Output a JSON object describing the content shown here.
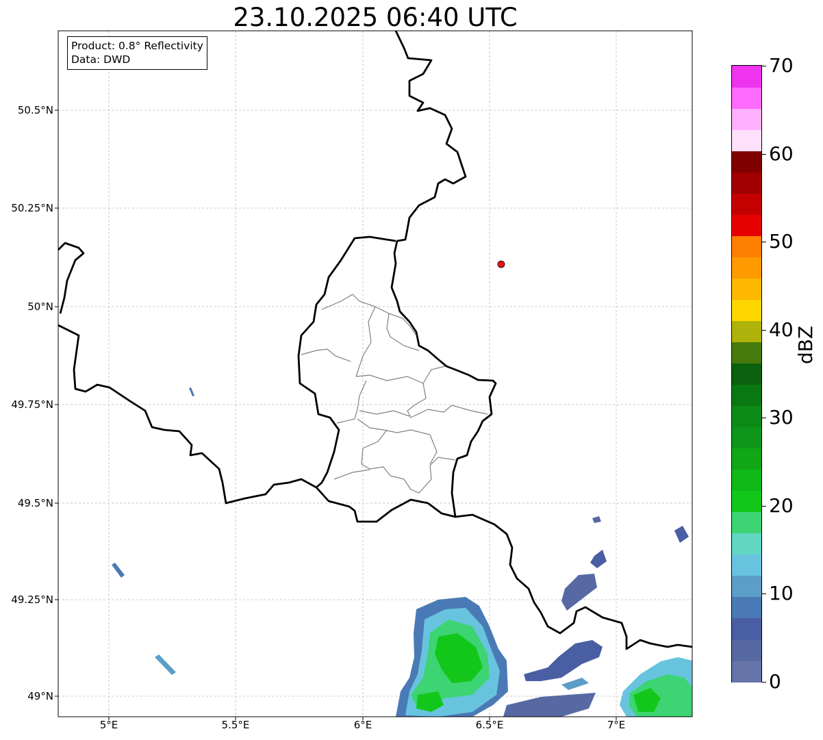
{
  "title": "23.10.2025 06:40 UTC",
  "info": {
    "product": "Product: 0.8° Reflectivity",
    "source": "Data: DWD"
  },
  "axes": {
    "lon_ticks": [
      "5°E",
      "5.5°E",
      "6°E",
      "6.5°E",
      "7°E"
    ],
    "lat_ticks": [
      "50.5°N",
      "50.25°N",
      "50°N",
      "49.75°N",
      "49.5°N",
      "49.25°N",
      "49°N"
    ],
    "lon_range": [
      4.8,
      7.3
    ],
    "lat_range": [
      48.95,
      50.7
    ]
  },
  "radar_site": {
    "lon": 6.55,
    "lat": 50.11,
    "color": "#e8141a"
  },
  "colorbar": {
    "label": "dBZ",
    "ticks": [
      "70",
      "60",
      "50",
      "40",
      "30",
      "20",
      "10",
      "0"
    ],
    "range": [
      0,
      70
    ],
    "colors": [
      "#6574a8",
      "#5669a3",
      "#4a5ea3",
      "#4a7ab5",
      "#5b9ec8",
      "#68c4de",
      "#60d6c3",
      "#3dd473",
      "#12c71a",
      "#10b818",
      "#10a615",
      "#0e961b",
      "#0c8a16",
      "#0a7812",
      "#0b610d",
      "#477a0d",
      "#afb20a",
      "#ffd700",
      "#ffb800",
      "#ff9b00",
      "#ff8000",
      "#e70000",
      "#c40000",
      "#a00000",
      "#800000",
      "#ffe0fb",
      "#ffb0ff",
      "#ff6aff",
      "#ee34ee"
    ]
  }
}
